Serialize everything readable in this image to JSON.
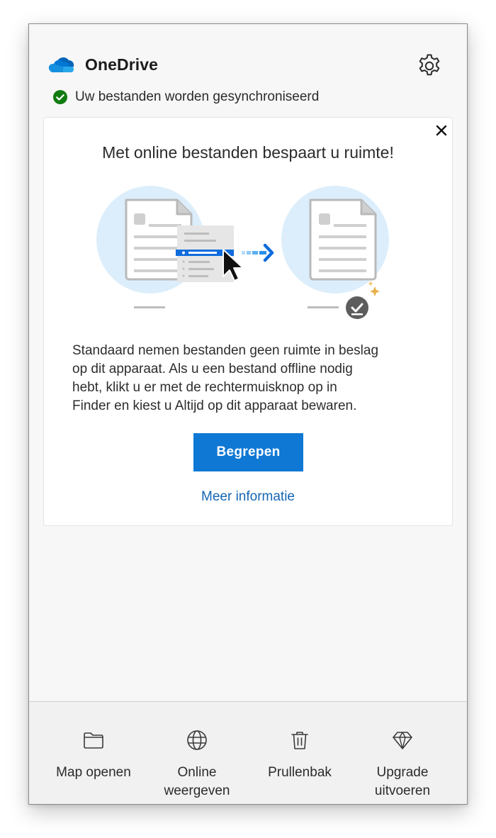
{
  "header": {
    "app_title": "OneDrive",
    "logo_icon": "onedrive-cloud-icon",
    "settings_icon": "gear-icon"
  },
  "status": {
    "icon": "check-circle-icon",
    "text": "Uw bestanden worden gesynchroniseerd",
    "color": "#107c10"
  },
  "card": {
    "close_icon": "close-icon",
    "title": "Met online bestanden bespaart u ruimte!",
    "body": "Standaard nemen bestanden geen ruimte in beslag\nop dit apparaat.  Als u een bestand offline nodig\nhebt, klikt u er met de rechtermuisknop op in\nFinder en kiest u Altijd op dit apparaat bewaren.",
    "primary_button": "Begrepen",
    "link": "Meer informatie",
    "accent": "#0f78d4"
  },
  "footer": {
    "items": [
      {
        "label": "Map openen",
        "icon": "folder-icon"
      },
      {
        "label": "Online\nweergeven",
        "icon": "globe-icon"
      },
      {
        "label": "Prullenbak",
        "icon": "trash-icon"
      },
      {
        "label": "Upgrade\nuitvoeren",
        "icon": "diamond-icon"
      }
    ]
  }
}
